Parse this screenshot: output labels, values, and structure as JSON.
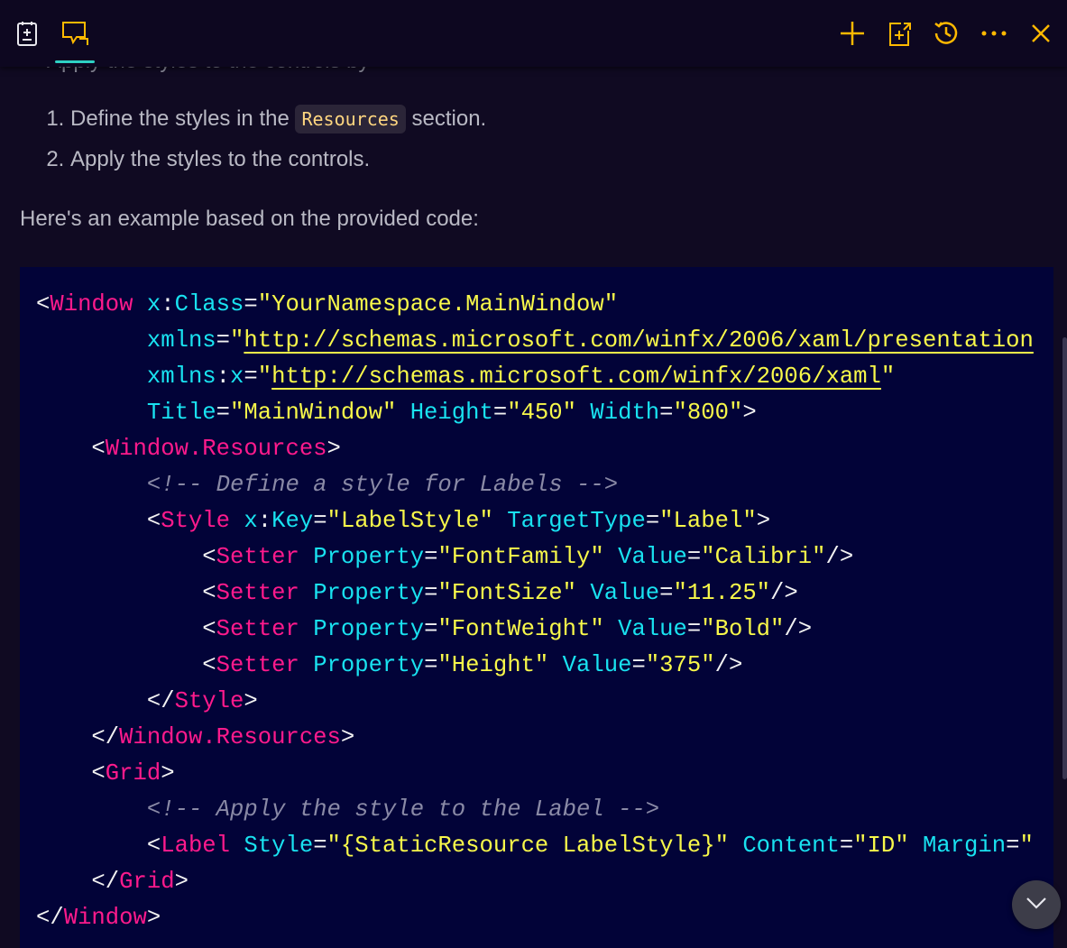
{
  "toolbar": {
    "left_icons": [
      "notebook-add-icon",
      "chat-icon"
    ],
    "right_icons": [
      "plus-icon",
      "export-icon",
      "history-icon",
      "more-icon",
      "close-icon"
    ],
    "accent_color": "#ffb900",
    "active_underline_color": "#2ed1c3"
  },
  "content": {
    "clipped_line": "Apply the styles to the controls by",
    "steps": [
      {
        "before": "Define the styles in the ",
        "code": "Resources",
        "after": " section."
      },
      {
        "before": "Apply the styles to the controls.",
        "code": "",
        "after": ""
      }
    ],
    "intro": "Here's an example based on the provided code:"
  },
  "code": {
    "lines": [
      [
        [
          "p",
          "<"
        ],
        [
          "t",
          "Window"
        ],
        [
          "p",
          " "
        ],
        [
          "a",
          "x"
        ],
        [
          "p",
          ":"
        ],
        [
          "a",
          "Class"
        ],
        [
          "p",
          "="
        ],
        [
          "s",
          "\"YourNamespace.MainWindow\""
        ]
      ],
      [
        [
          "p",
          "        "
        ],
        [
          "a",
          "xmlns"
        ],
        [
          "p",
          "="
        ],
        [
          "s",
          "\""
        ],
        [
          "u",
          "http://schemas.microsoft.com/winfx/2006/xaml/presentation"
        ]
      ],
      [
        [
          "p",
          "        "
        ],
        [
          "a",
          "xmlns"
        ],
        [
          "p",
          ":"
        ],
        [
          "a",
          "x"
        ],
        [
          "p",
          "="
        ],
        [
          "s",
          "\""
        ],
        [
          "u",
          "http://schemas.microsoft.com/winfx/2006/xaml"
        ],
        [
          "s",
          "\""
        ]
      ],
      [
        [
          "p",
          "        "
        ],
        [
          "a",
          "Title"
        ],
        [
          "p",
          "="
        ],
        [
          "s",
          "\"MainWindow\""
        ],
        [
          "p",
          " "
        ],
        [
          "a",
          "Height"
        ],
        [
          "p",
          "="
        ],
        [
          "s",
          "\"450\""
        ],
        [
          "p",
          " "
        ],
        [
          "a",
          "Width"
        ],
        [
          "p",
          "="
        ],
        [
          "s",
          "\"800\""
        ],
        [
          "p",
          ">"
        ]
      ],
      [
        [
          "p",
          "    <"
        ],
        [
          "t",
          "Window.Resources"
        ],
        [
          "p",
          ">"
        ]
      ],
      [
        [
          "p",
          "        "
        ],
        [
          "c",
          "<!-- Define a style for Labels -->"
        ]
      ],
      [
        [
          "p",
          "        <"
        ],
        [
          "t",
          "Style"
        ],
        [
          "p",
          " "
        ],
        [
          "a",
          "x"
        ],
        [
          "p",
          ":"
        ],
        [
          "a",
          "Key"
        ],
        [
          "p",
          "="
        ],
        [
          "s",
          "\"LabelStyle\""
        ],
        [
          "p",
          " "
        ],
        [
          "a",
          "TargetType"
        ],
        [
          "p",
          "="
        ],
        [
          "s",
          "\"Label\""
        ],
        [
          "p",
          ">"
        ]
      ],
      [
        [
          "p",
          "            <"
        ],
        [
          "t",
          "Setter"
        ],
        [
          "p",
          " "
        ],
        [
          "a",
          "Property"
        ],
        [
          "p",
          "="
        ],
        [
          "s",
          "\"FontFamily\""
        ],
        [
          "p",
          " "
        ],
        [
          "a",
          "Value"
        ],
        [
          "p",
          "="
        ],
        [
          "s",
          "\"Calibri\""
        ],
        [
          "p",
          "/>"
        ]
      ],
      [
        [
          "p",
          "            <"
        ],
        [
          "t",
          "Setter"
        ],
        [
          "p",
          " "
        ],
        [
          "a",
          "Property"
        ],
        [
          "p",
          "="
        ],
        [
          "s",
          "\"FontSize\""
        ],
        [
          "p",
          " "
        ],
        [
          "a",
          "Value"
        ],
        [
          "p",
          "="
        ],
        [
          "s",
          "\"11.25\""
        ],
        [
          "p",
          "/>"
        ]
      ],
      [
        [
          "p",
          "            <"
        ],
        [
          "t",
          "Setter"
        ],
        [
          "p",
          " "
        ],
        [
          "a",
          "Property"
        ],
        [
          "p",
          "="
        ],
        [
          "s",
          "\"FontWeight\""
        ],
        [
          "p",
          " "
        ],
        [
          "a",
          "Value"
        ],
        [
          "p",
          "="
        ],
        [
          "s",
          "\"Bold\""
        ],
        [
          "p",
          "/>"
        ]
      ],
      [
        [
          "p",
          "            <"
        ],
        [
          "t",
          "Setter"
        ],
        [
          "p",
          " "
        ],
        [
          "a",
          "Property"
        ],
        [
          "p",
          "="
        ],
        [
          "s",
          "\"Height\""
        ],
        [
          "p",
          " "
        ],
        [
          "a",
          "Value"
        ],
        [
          "p",
          "="
        ],
        [
          "s",
          "\"375\""
        ],
        [
          "p",
          "/>"
        ]
      ],
      [
        [
          "p",
          "        </"
        ],
        [
          "t",
          "Style"
        ],
        [
          "p",
          ">"
        ]
      ],
      [
        [
          "p",
          "    </"
        ],
        [
          "t",
          "Window.Resources"
        ],
        [
          "p",
          ">"
        ]
      ],
      [
        [
          "p",
          "    <"
        ],
        [
          "t",
          "Grid"
        ],
        [
          "p",
          ">"
        ]
      ],
      [
        [
          "p",
          "        "
        ],
        [
          "c",
          "<!-- Apply the style to the Label -->"
        ]
      ],
      [
        [
          "p",
          "        <"
        ],
        [
          "t",
          "Label"
        ],
        [
          "p",
          " "
        ],
        [
          "a",
          "Style"
        ],
        [
          "p",
          "="
        ],
        [
          "s",
          "\"{StaticResource LabelStyle}\""
        ],
        [
          "p",
          " "
        ],
        [
          "a",
          "Content"
        ],
        [
          "p",
          "="
        ],
        [
          "s",
          "\"ID\""
        ],
        [
          "p",
          " "
        ],
        [
          "a",
          "Margin"
        ],
        [
          "p",
          "="
        ],
        [
          "s",
          "\""
        ]
      ],
      [
        [
          "p",
          "    </"
        ],
        [
          "t",
          "Grid"
        ],
        [
          "p",
          ">"
        ]
      ],
      [
        [
          "p",
          "</"
        ],
        [
          "t",
          "Window"
        ],
        [
          "p",
          ">"
        ]
      ]
    ]
  },
  "scroll_button": {
    "icon": "chevron-down-icon"
  }
}
